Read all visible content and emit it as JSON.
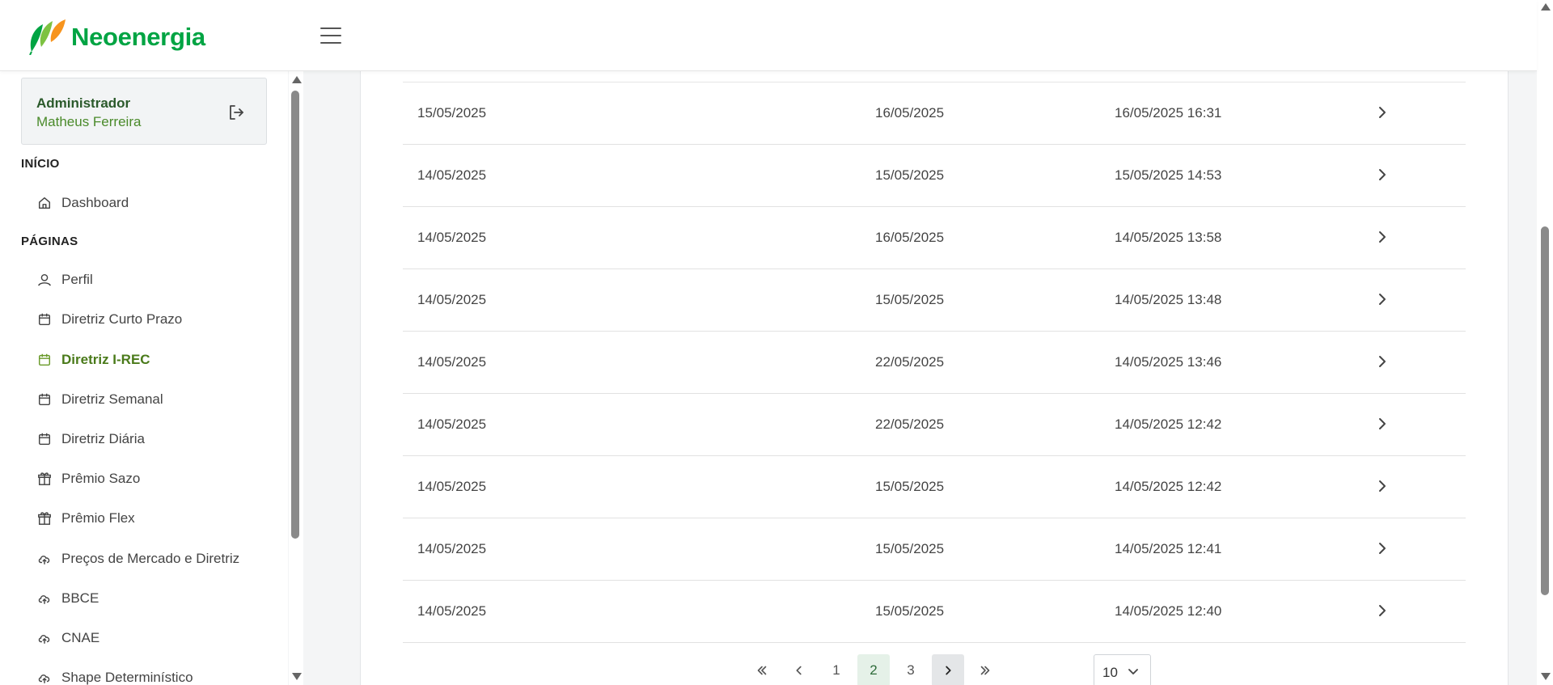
{
  "header": {
    "brand": "Neoenergia",
    "menu_icon": "hamburger-menu-icon"
  },
  "user": {
    "role": "Administrador",
    "name": "Matheus Ferreira",
    "logout_icon": "logout-icon"
  },
  "sidebar": {
    "sections": [
      {
        "title": "INÍCIO"
      },
      {
        "title": "PÁGINAS"
      }
    ],
    "items": [
      {
        "label": "Dashboard",
        "icon": "home-icon",
        "active": false
      },
      {
        "label": "Perfil",
        "icon": "user-icon",
        "active": false
      },
      {
        "label": "Diretriz Curto Prazo",
        "icon": "calendar-icon",
        "active": false
      },
      {
        "label": "Diretriz I-REC",
        "icon": "calendar-icon",
        "active": true
      },
      {
        "label": "Diretriz Semanal",
        "icon": "calendar-icon",
        "active": false
      },
      {
        "label": "Diretriz Diária",
        "icon": "calendar-icon",
        "active": false
      },
      {
        "label": "Prêmio Sazo",
        "icon": "gift-icon",
        "active": false
      },
      {
        "label": "Prêmio Flex",
        "icon": "gift-icon",
        "active": false
      },
      {
        "label": "Preços de Mercado e Diretriz",
        "icon": "cloud-upload-icon",
        "active": false
      },
      {
        "label": "BBCE",
        "icon": "cloud-upload-icon",
        "active": false
      },
      {
        "label": "CNAE",
        "icon": "cloud-upload-icon",
        "active": false
      },
      {
        "label": "Shape Determinístico",
        "icon": "cloud-upload-icon",
        "active": false
      }
    ]
  },
  "table": {
    "rows": [
      {
        "c1": "15/05/2025",
        "c2": "16/05/2025",
        "c3": "16/05/2025 16:31"
      },
      {
        "c1": "14/05/2025",
        "c2": "15/05/2025",
        "c3": "15/05/2025 14:53"
      },
      {
        "c1": "14/05/2025",
        "c2": "16/05/2025",
        "c3": "14/05/2025 13:58"
      },
      {
        "c1": "14/05/2025",
        "c2": "15/05/2025",
        "c3": "14/05/2025 13:48"
      },
      {
        "c1": "14/05/2025",
        "c2": "22/05/2025",
        "c3": "14/05/2025 13:46"
      },
      {
        "c1": "14/05/2025",
        "c2": "22/05/2025",
        "c3": "14/05/2025 12:42"
      },
      {
        "c1": "14/05/2025",
        "c2": "15/05/2025",
        "c3": "14/05/2025 12:42"
      },
      {
        "c1": "14/05/2025",
        "c2": "15/05/2025",
        "c3": "14/05/2025 12:41"
      },
      {
        "c1": "14/05/2025",
        "c2": "15/05/2025",
        "c3": "14/05/2025 12:40"
      }
    ]
  },
  "pagination": {
    "pages": [
      "1",
      "2",
      "3"
    ],
    "current_page": "2",
    "page_size": "10"
  },
  "colors": {
    "brand_green": "#00a443",
    "brand_orange": "#f7941d",
    "active_nav": "#4a7a1a",
    "active_page_bg": "#e5f1e8"
  }
}
